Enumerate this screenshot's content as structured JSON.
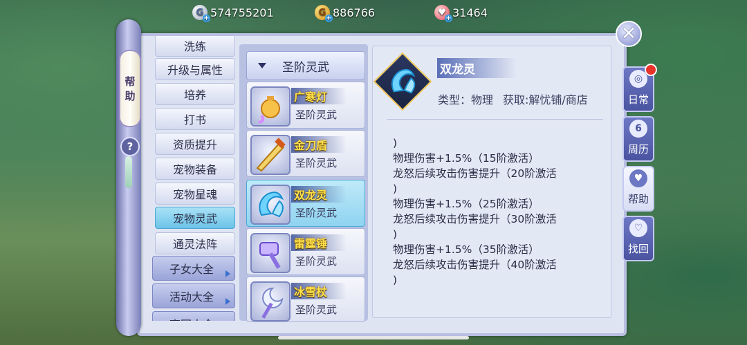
{
  "currencies": [
    {
      "name": "silver",
      "symbol": "G",
      "value": "574755201"
    },
    {
      "name": "gold",
      "symbol": "G",
      "value": "886766"
    },
    {
      "name": "heart",
      "symbol": "♥",
      "value": "31464"
    }
  ],
  "help_tag": [
    "帮",
    "助"
  ],
  "help_q": "?",
  "close_symbol": "✕",
  "menu": {
    "items": [
      {
        "label": "洗练",
        "active": false
      },
      {
        "label": "升级与属性",
        "active": false
      },
      {
        "label": "培养",
        "active": false
      },
      {
        "label": "打书",
        "active": false
      },
      {
        "label": "资质提升",
        "active": false
      },
      {
        "label": "宠物装备",
        "active": false
      },
      {
        "label": "宠物星魂",
        "active": false
      },
      {
        "label": "宠物灵武",
        "active": true
      },
      {
        "label": "通灵法阵",
        "active": false
      }
    ],
    "categories": [
      {
        "label": "子女大全"
      },
      {
        "label": "活动大全"
      },
      {
        "label": "高园大全"
      }
    ]
  },
  "list": {
    "header": "圣阶灵武",
    "weapons": [
      {
        "name": "广寒灯",
        "grade": "圣阶灵武",
        "icon": "lantern-icon",
        "active": false
      },
      {
        "name": "金刀盾",
        "grade": "圣阶灵武",
        "icon": "golden-blade-icon",
        "active": false
      },
      {
        "name": "双龙灵",
        "grade": "圣阶灵武",
        "icon": "twin-dragon-icon",
        "active": true
      },
      {
        "name": "雷霆锤",
        "grade": "圣阶灵武",
        "icon": "thunder-hammer-icon",
        "active": false
      },
      {
        "name": "冰雪杖",
        "grade": "圣阶灵武",
        "icon": "ice-staff-icon",
        "active": false
      }
    ]
  },
  "detail": {
    "name": "双龙灵",
    "type_label": "类型：物理",
    "source_label": "获取:解忧铺/商店",
    "description": ")\n物理伤害+1.5%（15阶激活）\n龙怒后续攻击伤害提升（20阶激活\n)\n物理伤害+1.5%（25阶激活）\n龙怒后续攻击伤害提升（30阶激活\n)\n物理伤害+1.5%（35阶激活）\n龙怒后续攻击伤害提升（40阶激活\n)"
  },
  "side_tabs": [
    {
      "label": "日常",
      "icon": "lantern-icon",
      "active": false,
      "notify": true
    },
    {
      "label": "周历",
      "icon": "calendar-icon",
      "icon_text": "6",
      "active": false
    },
    {
      "label": "帮助",
      "icon": "heart-hand-icon",
      "active": true
    },
    {
      "label": "找回",
      "icon": "recover-icon",
      "active": false
    }
  ],
  "colors": {
    "accent": "#6cc3e8",
    "panel": "#dfe4f3",
    "tab": "#4a54a0",
    "name": "#ffe14a"
  }
}
